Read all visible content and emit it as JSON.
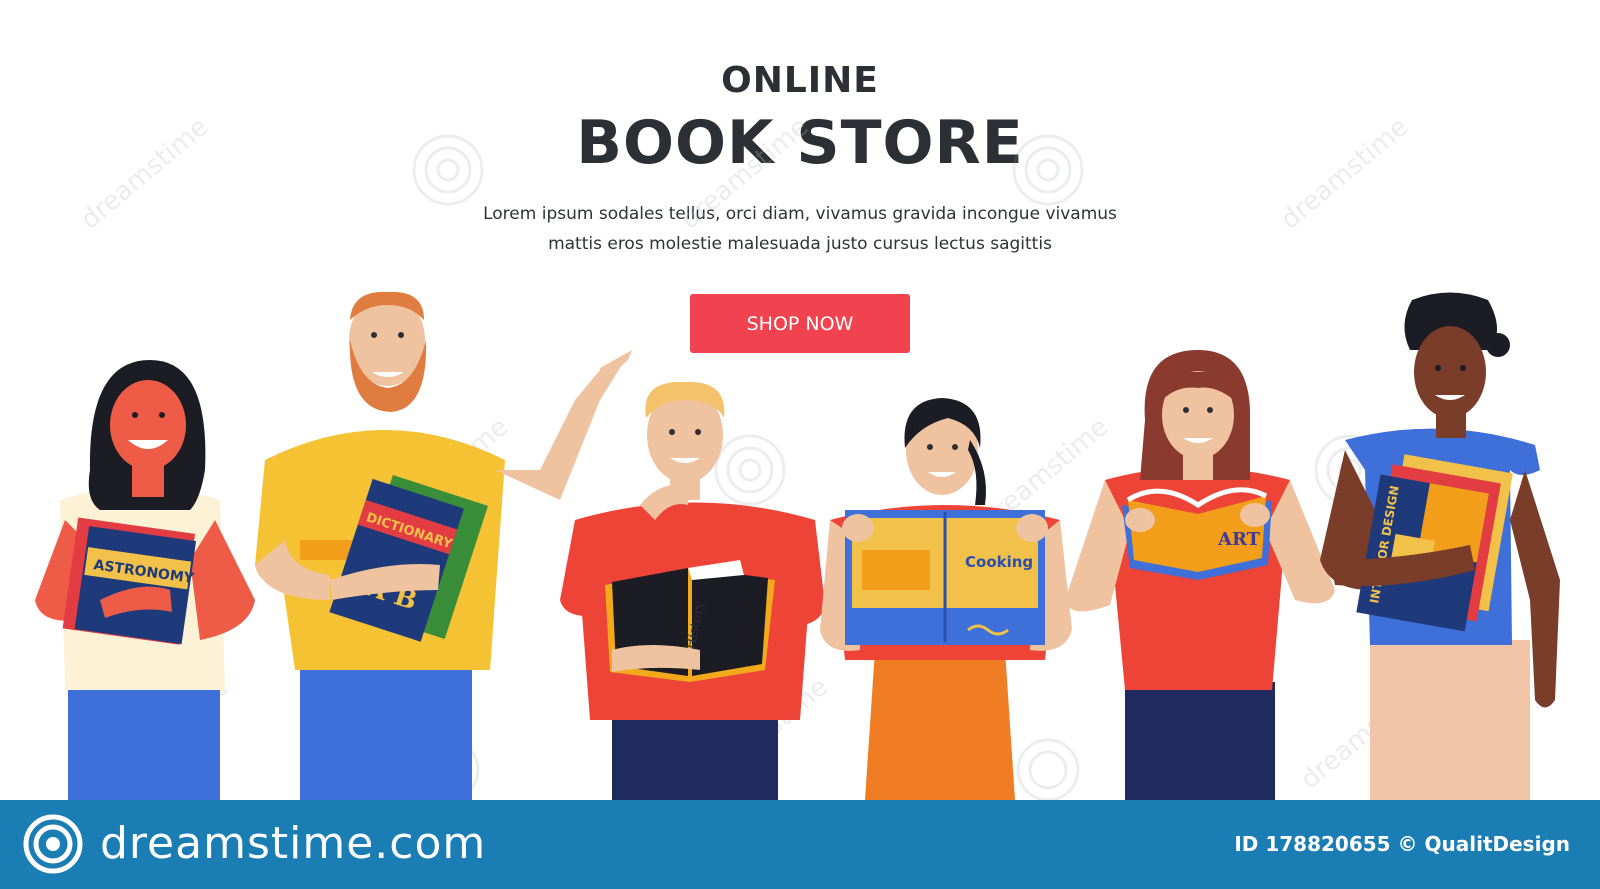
{
  "headline": {
    "top": "ONLINE",
    "main": "BOOK STORE"
  },
  "subtitle": {
    "line1": "Lorem ipsum sodales tellus, orci diam, vivamus gravida incongue vivamus",
    "line2": "mattis eros molestie malesuada justo cursus lectus sagittis"
  },
  "cta": {
    "label": "SHOP NOW",
    "color": "#f0434f"
  },
  "books": {
    "astronomy": "ASTRONOMY",
    "dictionary": "DICTIONARY",
    "dictionary_letters": "A B",
    "history": "History",
    "cooking": "Cooking",
    "art": "ART",
    "interior": "INTERIOR DESIGN"
  },
  "watermark": {
    "text": "dreamstime"
  },
  "footer": {
    "brand": "dreamstime.com",
    "credit": "ID 178820655 © QualitDesign",
    "bar_color": "#1a7db3"
  },
  "icons": [
    "dreamstime-logo-icon",
    "swirl-watermark-icon"
  ]
}
